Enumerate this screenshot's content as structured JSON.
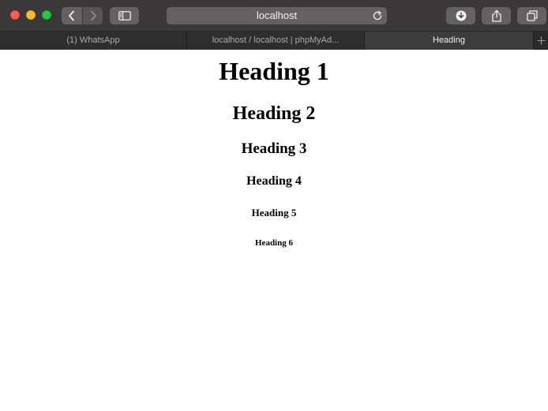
{
  "toolbar": {
    "address_text": "localhost",
    "back_icon": "chevron-left-icon",
    "forward_icon": "chevron-right-icon",
    "sidebar_icon": "sidebar-icon",
    "download_icon": "download-icon",
    "share_icon": "share-icon",
    "tabs_icon": "tab-overview-icon",
    "reload_icon": "reload-icon"
  },
  "tabs": [
    {
      "label": "(1) WhatsApp",
      "active": false
    },
    {
      "label": "localhost / localhost | phpMyAd...",
      "active": false
    },
    {
      "label": "Heading",
      "active": true
    }
  ],
  "page": {
    "headings": [
      "Heading 1",
      "Heading 2",
      "Heading 3",
      "Heading 4",
      "Heading 5",
      "Heading 6"
    ]
  },
  "colors": {
    "toolbar_bg": "#3a3838",
    "tabbar_bg": "#2b2a2a",
    "active_tab_bg": "#3d3c3c",
    "close": "#fe5f57",
    "minimize": "#febc2e",
    "zoom": "#28c840"
  }
}
